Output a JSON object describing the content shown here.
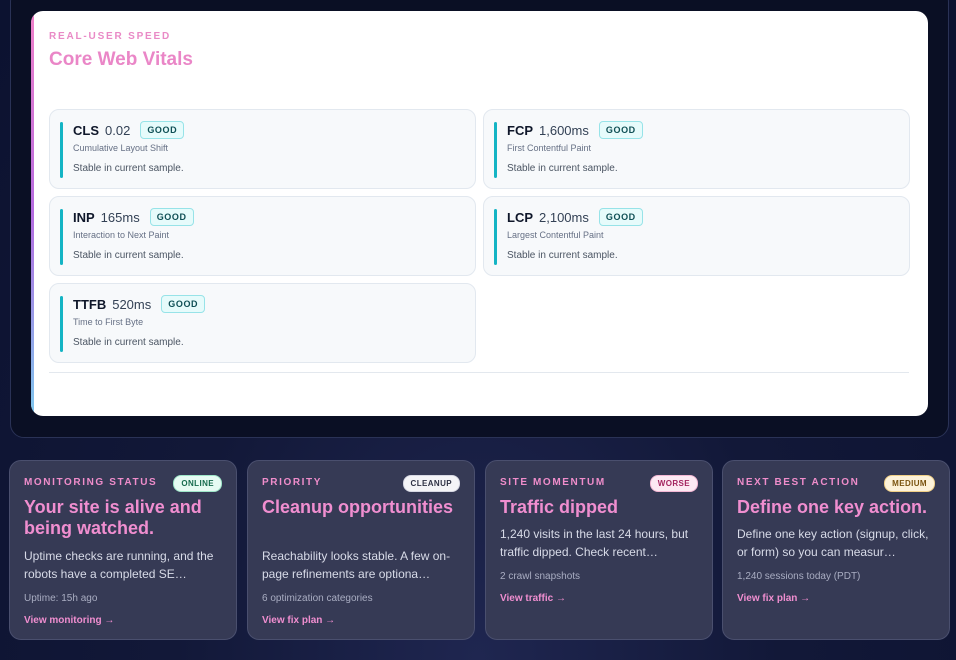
{
  "cwv": {
    "eyebrow": "REAL-USER SPEED",
    "title": "Core Web Vitals",
    "metrics": [
      {
        "abbr": "CLS",
        "value": "0.02",
        "status": "GOOD",
        "full": "Cumulative Layout Shift",
        "note": "Stable in current sample."
      },
      {
        "abbr": "FCP",
        "value": "1,600ms",
        "status": "GOOD",
        "full": "First Contentful Paint",
        "note": "Stable in current sample."
      },
      {
        "abbr": "INP",
        "value": "165ms",
        "status": "GOOD",
        "full": "Interaction to Next Paint",
        "note": "Stable in current sample."
      },
      {
        "abbr": "LCP",
        "value": "2,100ms",
        "status": "GOOD",
        "full": "Largest Contentful Paint",
        "note": "Stable in current sample."
      },
      {
        "abbr": "TTFB",
        "value": "520ms",
        "status": "GOOD",
        "full": "Time to First Byte",
        "note": "Stable in current sample."
      }
    ]
  },
  "cards": [
    {
      "eyebrow": "MONITORING STATUS",
      "tag": "ONLINE",
      "heading": "Your site is alive and being watched.",
      "body": "Uptime checks are running, and the robots have a completed SE…",
      "meta": "Uptime: 15h ago",
      "link": "View monitoring →"
    },
    {
      "eyebrow": "PRIORITY",
      "tag": "CLEANUP",
      "heading": "Cleanup opportunities",
      "body": "Reachability looks stable. A few on-page refinements are optiona…",
      "meta": "6 optimization categories",
      "link": "View fix plan →"
    },
    {
      "eyebrow": "SITE MOMENTUM",
      "tag": "WORSE",
      "heading": "Traffic dipped",
      "body": "1,240 visits in the last 24 hours, but traffic dipped. Check recent…",
      "meta": "2 crawl snapshots",
      "link": "View traffic →"
    },
    {
      "eyebrow": "NEXT BEST ACTION",
      "tag": "MEDIUM",
      "heading": "Define one key action.",
      "body": "Define one key action (signup, click, or form) so you can measur…",
      "meta": "1,240 sessions today (PDT)",
      "link": "View fix plan →"
    }
  ],
  "colors": {
    "accent_pink": "#f08ed0",
    "good_bar": "#14b4c4",
    "card_bg": "#363a55"
  }
}
